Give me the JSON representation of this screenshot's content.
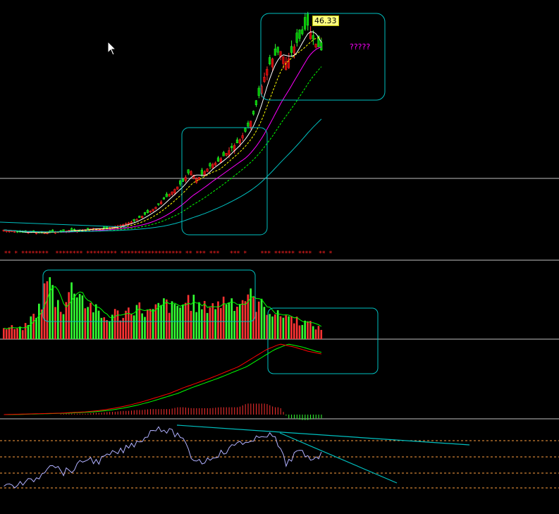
{
  "chart_data": [
    {
      "panel": "price",
      "type": "candlestick",
      "close_trend": [
        7.2,
        7.0,
        6.8,
        6.7,
        6.8,
        6.6,
        6.7,
        6.9,
        6.8,
        7.0,
        7.2,
        7.1,
        7.3,
        7.5,
        7.4,
        7.6,
        7.8,
        8.1,
        8.5,
        9.0,
        9.8,
        10.6,
        11.5,
        12.8,
        14.0,
        15.2,
        16.5,
        18.6,
        16.8,
        18.2,
        19.5,
        20.2,
        21.5,
        22.8,
        24.0,
        26.0,
        28.5,
        33.0,
        37.5,
        40.0,
        41.5,
        39.0,
        42.0,
        44.0,
        46.33,
        43.0,
        41.5
      ],
      "price_label": "46.33",
      "note": "?????",
      "moving_averages": [
        {
          "color": "#ffffff"
        },
        {
          "color": "#ffff00"
        },
        {
          "color": "#ff00ff"
        },
        {
          "color": "#00ff00"
        },
        {
          "color": "#00c0c0"
        }
      ]
    },
    {
      "panel": "volume",
      "type": "bar",
      "bar_colors": {
        "up": "#ff3333",
        "down": "#33ff33"
      },
      "average_color": "#00ff00"
    },
    {
      "panel": "macd",
      "type": "line",
      "series": [
        {
          "color": "#ff0000"
        },
        {
          "color": "#00ff00"
        }
      ]
    },
    {
      "panel": "oscillator",
      "type": "line",
      "line_color": "#b0b0ff",
      "reference_line_color": "#ffa040"
    }
  ],
  "colors": {
    "background": "#000000",
    "frame": "#00c0c0",
    "separator": "#c0c0c0"
  }
}
